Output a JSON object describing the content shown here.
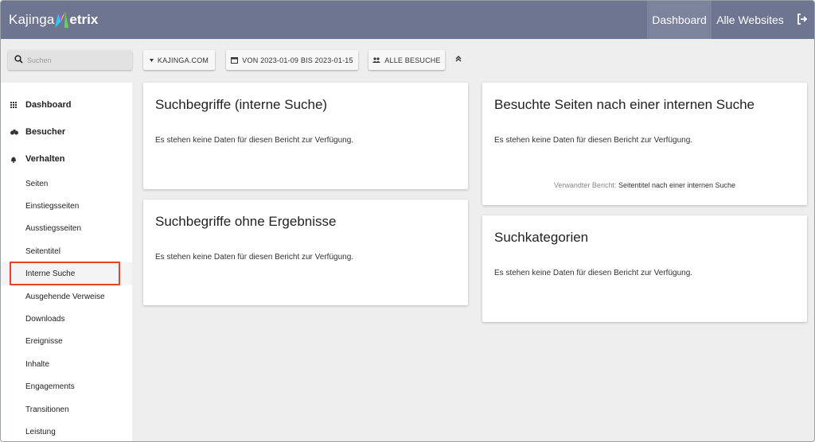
{
  "header": {
    "logo_prefix": "Kajinga",
    "logo_suffix": "etrix",
    "nav_dashboard": "Dashboard",
    "nav_websites": "Alle Websites",
    "logout_icon": "logout-icon"
  },
  "controls": {
    "search_placeholder": "Suchen",
    "site_label": "KAJINGA.COM",
    "date_label": "VON 2023-01-09 BIS 2023-01-15",
    "segment_label": "ALLE BESUCHE"
  },
  "sidebar": {
    "sections": [
      {
        "label": "Dashboard",
        "icon": "grid-icon"
      },
      {
        "label": "Besucher",
        "icon": "binoculars-icon"
      },
      {
        "label": "Verhalten",
        "icon": "bell-icon"
      }
    ],
    "items": [
      {
        "label": "Seiten"
      },
      {
        "label": "Einstiegsseiten"
      },
      {
        "label": "Ausstiegsseiten"
      },
      {
        "label": "Seitentitel"
      },
      {
        "label": "Interne Suche",
        "active": true
      },
      {
        "label": "Ausgehende Verweise"
      },
      {
        "label": "Downloads"
      },
      {
        "label": "Ereignisse"
      },
      {
        "label": "Inhalte"
      },
      {
        "label": "Engagements"
      },
      {
        "label": "Transitionen"
      },
      {
        "label": "Leistung"
      }
    ]
  },
  "reports": {
    "search_terms": {
      "title": "Suchbegriffe (interne Suche)",
      "message": "Es stehen keine Daten für diesen Bericht zur Verfügung."
    },
    "no_results": {
      "title": "Suchbegriffe ohne Ergebnisse",
      "message": "Es stehen keine Daten für diesen Bericht zur Verfügung."
    },
    "visited_pages": {
      "title": "Besuchte Seiten nach einer internen Suche",
      "message": "Es stehen keine Daten für diesen Bericht zur Verfügung.",
      "related_prefix": "Verwandter Bericht:",
      "related_link": "Seitentitel nach einer internen Suche"
    },
    "categories": {
      "title": "Suchkategorien",
      "message": "Es stehen keine Daten für diesen Bericht zur Verfügung."
    }
  },
  "colors": {
    "header_bg": "#6e7590",
    "highlight": "#e5442b"
  }
}
